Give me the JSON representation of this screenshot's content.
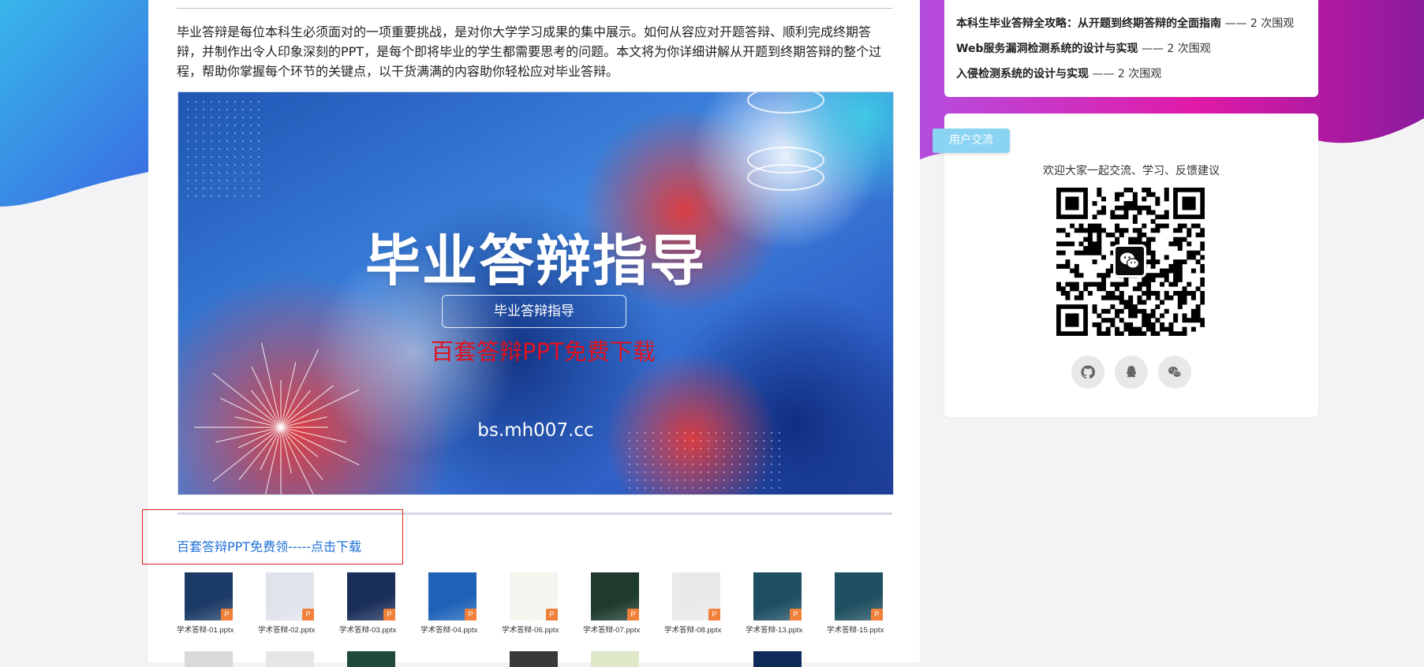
{
  "article": {
    "intro": "毕业答辩是每位本科生必须面对的一项重要挑战，是对你大学学习成果的集中展示。如何从容应对开题答辩、顺利完成终期答辩，并制作出令人印象深刻的PPT，是每个即将毕业的学生都需要思考的问题。本文将为你详细讲解从开题到终期答辩的整个过程，帮助你掌握每个环节的关键点，以干货满满的内容助你轻松应对毕业答辩。",
    "banner": {
      "title": "毕业答辩指导",
      "subtitle": "毕业答辩指导",
      "promo": "百套答辩PPT免费下载",
      "url": "bs.mh007.cc"
    },
    "download_link": "百套答辩PPT免费领-----点击下载",
    "files": [
      {
        "name": "学术答辩-01.pptx",
        "color": "#1c3a66"
      },
      {
        "name": "学术答辩-02.pptx",
        "color": "#dfe3ea"
      },
      {
        "name": "学术答辩-03.pptx",
        "color": "#1a2f5a"
      },
      {
        "name": "学术答辩-04.pptx",
        "color": "#1e62b8"
      },
      {
        "name": "学术答辩-06.pptx",
        "color": "#f3f6ee"
      },
      {
        "name": "学术答辩-07.pptx",
        "color": "#1e3b2d"
      },
      {
        "name": "学术答辩-08.pptx",
        "color": "#e9e9e9"
      },
      {
        "name": "学术答辩-13.pptx",
        "color": "#1d4e62"
      },
      {
        "name": "学术答辩-15.pptx",
        "color": "#1f4f60"
      }
    ],
    "file_badge": "P"
  },
  "sidebar": {
    "articles": [
      {
        "title": "本科生毕业答辩全攻略：从开题到终期答辩的全面指南",
        "views": " —— 2 次围观"
      },
      {
        "title": "Web服务漏洞检测系统的设计与实现",
        "views": " —— 2 次围观"
      },
      {
        "title": "入侵检测系统的设计与实现",
        "views": " —— 2 次围观"
      }
    ],
    "community": {
      "tag": "用户交流",
      "welcome": "欢迎大家一起交流、学习、反馈建议"
    },
    "socials": [
      "github-icon",
      "qq-icon",
      "wechat-icon"
    ]
  }
}
